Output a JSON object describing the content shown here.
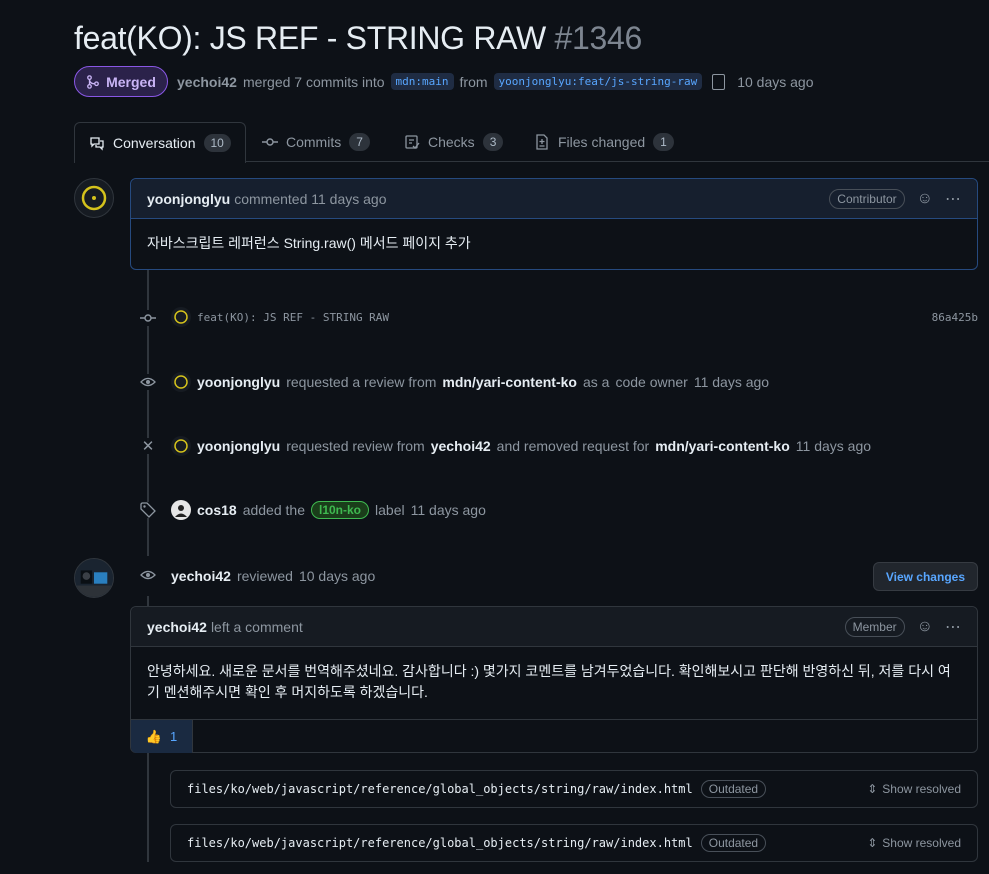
{
  "pr": {
    "title": "feat(KO): JS REF - STRING RAW",
    "number": "#1346",
    "status": "Merged",
    "merger": "yechoi42",
    "merged_text": "merged 7 commits into",
    "base_branch": "mdn:main",
    "from_text": "from",
    "head_branch": "yoonjonglyu:feat/js-string-raw",
    "time": "10 days ago"
  },
  "tabs": [
    {
      "label": "Conversation",
      "count": "10"
    },
    {
      "label": "Commits",
      "count": "7"
    },
    {
      "label": "Checks",
      "count": "3"
    },
    {
      "label": "Files changed",
      "count": "1"
    }
  ],
  "first_comment": {
    "author": "yoonjonglyu",
    "action": "commented 11 days ago",
    "role": "Contributor",
    "body": "자바스크립트 레퍼런스 String.raw() 메서드 페이지 추가"
  },
  "commit": {
    "message": "feat(KO): JS REF - STRING RAW",
    "sha": "86a425b"
  },
  "events": {
    "review_request": {
      "user": "yoonjonglyu",
      "text1": "requested a review from",
      "team": "mdn/yari-content-ko",
      "text2": "as a",
      "text3": "code owner",
      "time": "11 days ago"
    },
    "review_change": {
      "user": "yoonjonglyu",
      "text1": "requested review from",
      "reviewer": "yechoi42",
      "text2": "and removed request for",
      "team": "mdn/yari-content-ko",
      "time": "11 days ago"
    },
    "label": {
      "user": "cos18",
      "text1": "added the",
      "label": "l10n-ko",
      "text2": "label",
      "time": "11 days ago"
    },
    "reviewed": {
      "user": "yechoi42",
      "text": "reviewed",
      "time": "10 days ago",
      "button": "View changes"
    }
  },
  "review_comment": {
    "author": "yechoi42",
    "action": "left a comment",
    "role": "Member",
    "body": "안녕하세요. 새로운 문서를 번역해주셨네요. 감사합니다 :) 몇가지 코멘트를 남겨두었습니다. 확인해보시고 판단해 반영하신 뒤, 저를 다시 여기 멘션해주시면 확인 후 머지하도록 하겠습니다.",
    "reaction_count": "1"
  },
  "files": [
    {
      "path": "files/ko/web/javascript/reference/global_objects/string/raw/index.html",
      "badge": "Outdated",
      "action": "Show resolved"
    },
    {
      "path": "files/ko/web/javascript/reference/global_objects/string/raw/index.html",
      "badge": "Outdated",
      "action": "Show resolved"
    }
  ],
  "colors": {
    "accent": "#58a6ff",
    "merged": "#8957e5",
    "label_green": "#3fb950"
  }
}
